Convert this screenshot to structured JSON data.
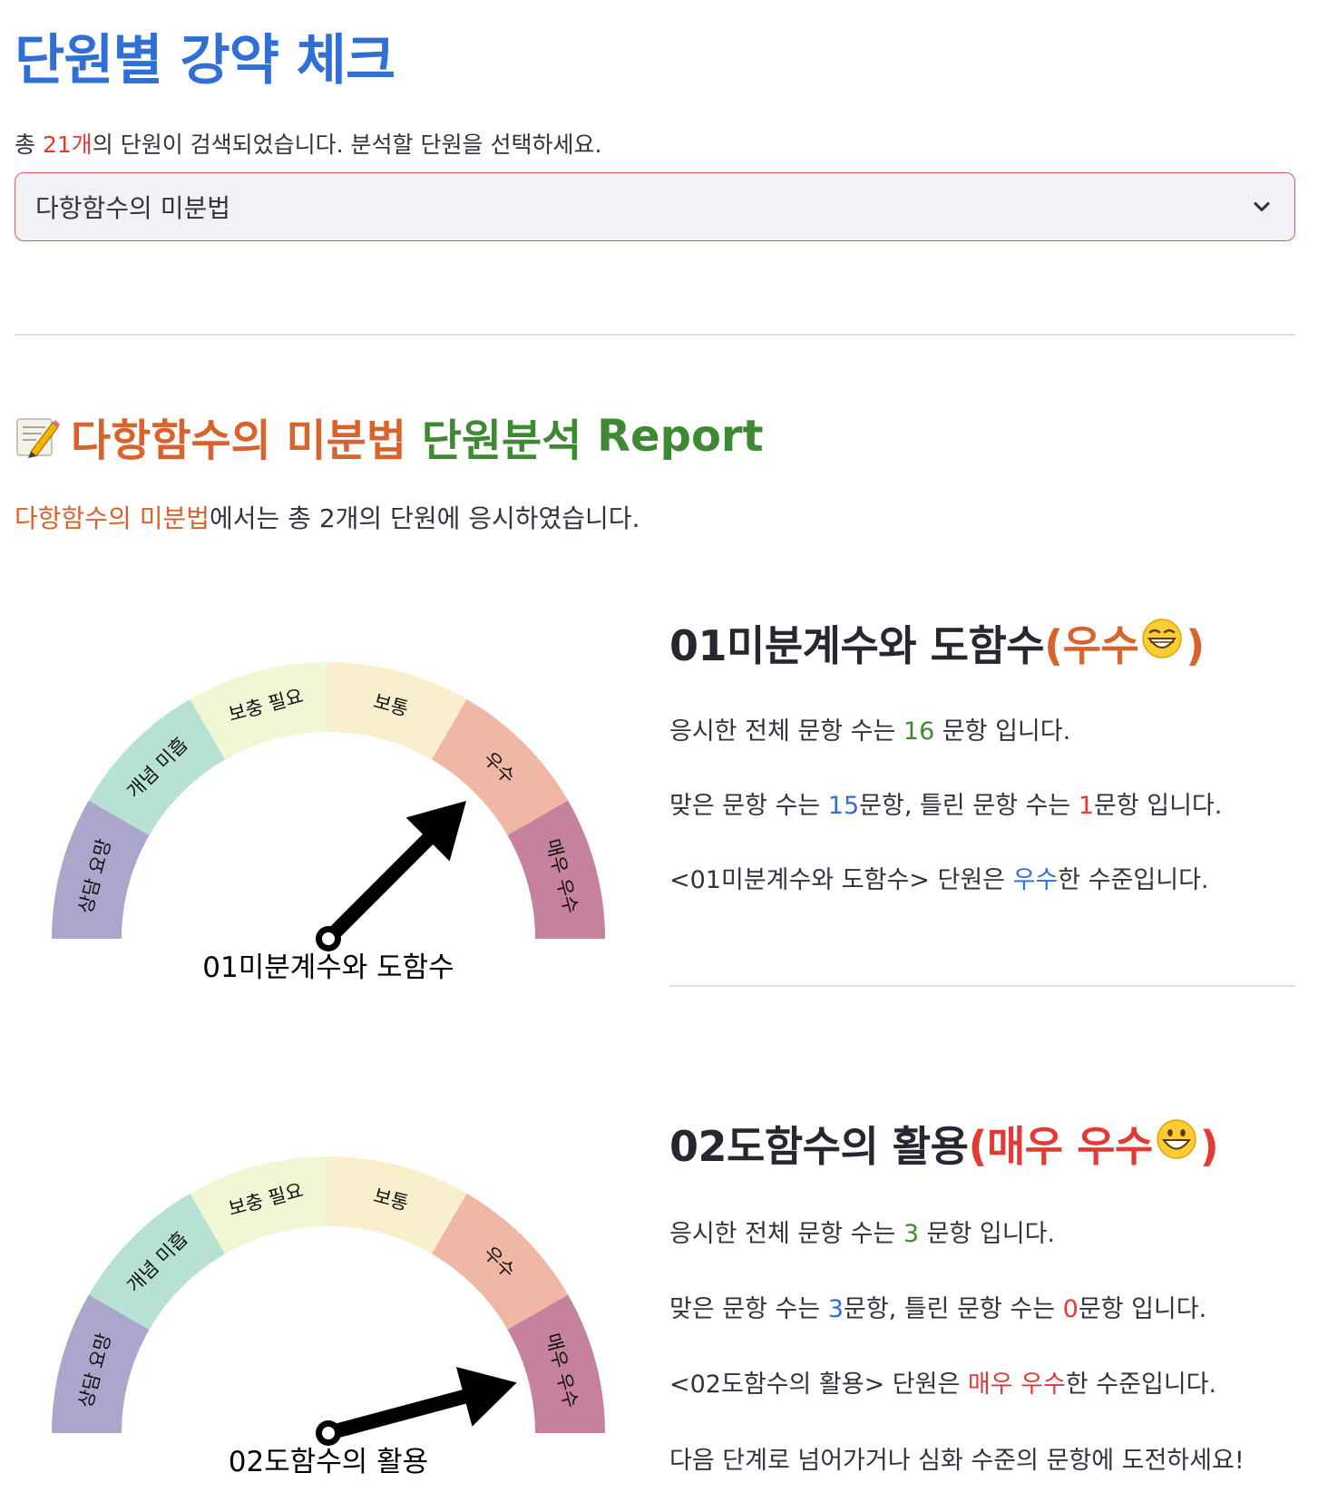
{
  "page": {
    "title": "단원별 강약 체크",
    "count_prefix": "총 ",
    "count_value": "21개",
    "count_suffix": "의 단원이 검색되었습니다. 분석할 단원을 선택하세요."
  },
  "select": {
    "value": "다항함수의 미분법"
  },
  "report": {
    "unit_name": "다항함수의 미분법",
    "title_mid": "단원분석",
    "title_tail": "Report",
    "summary_suffix": "에서는 총 2개의 단원에 응시하였습니다."
  },
  "gauge_bands": [
    "상담 요망",
    "개념 미흡",
    "보충 필요",
    "보통",
    "우수",
    "매우 우수"
  ],
  "gauge_colors": [
    "#aba6cc",
    "#b7e1d2",
    "#eff7d4",
    "#faefcc",
    "#f0b8a4",
    "#c6819c"
  ],
  "units": [
    {
      "name": "01미분계수와 도함수",
      "level": "우수",
      "level_color": "#d9632c",
      "emoji": "grinning-squinting-face",
      "gauge_label": "01미분계수와 도함수",
      "needle_angle_deg": 45,
      "total_prefix": "응시한 전체 문항 수는 ",
      "total": "16",
      "total_suffix": " 문항 입니다.",
      "correct_prefix": "맞은 문항 수는 ",
      "correct": "15",
      "correct_mid": "문항, 틀린 문항 수는 ",
      "wrong": "1",
      "wrong_suffix": "문항 입니다.",
      "level_line_prefix": "<01미분계수와 도함수> 단원은 ",
      "level_line_value": "우수",
      "level_line_value_color": "#2f6fd6",
      "level_line_suffix": "한 수준입니다."
    },
    {
      "name": "02도함수의 활용",
      "level": "매우 우수",
      "level_color": "#e53935",
      "emoji": "grinning-face",
      "gauge_label": "02도함수의 활용",
      "needle_angle_deg": 15,
      "total_prefix": "응시한 전체 문항 수는 ",
      "total": "3",
      "total_suffix": " 문항 입니다.",
      "correct_prefix": "맞은 문항 수는 ",
      "correct": "3",
      "correct_mid": "문항, 틀린 문항 수는 ",
      "wrong": "0",
      "wrong_suffix": "문항 입니다.",
      "level_line_prefix": "<02도함수의 활용> 단원은 ",
      "level_line_value": "매우 우수",
      "level_line_value_color": "#e53935",
      "level_line_suffix": "한 수준입니다.",
      "advice": "다음 단계로 넘어가거나 심화 수준의 문항에 도전하세요!"
    }
  ]
}
